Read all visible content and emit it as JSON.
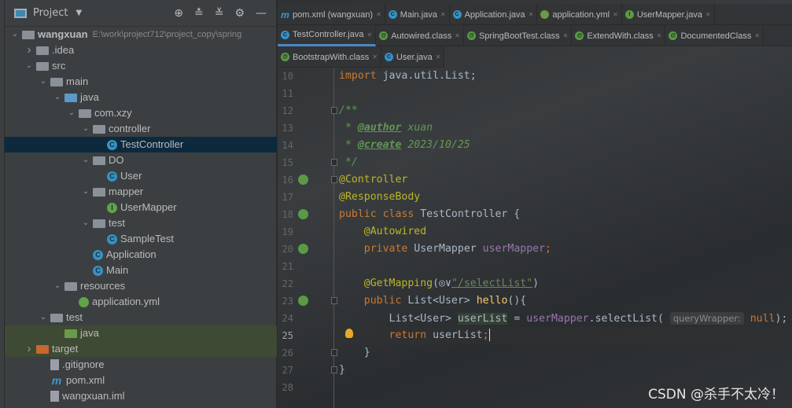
{
  "project_panel": {
    "title": "Project",
    "tools": [
      "locate-icon",
      "expand-all-icon",
      "collapse-all-icon",
      "gear-icon",
      "minimize-icon"
    ],
    "tree": [
      {
        "label": "wangxuan",
        "path": "E:\\work\\project712\\project_copy\\spring",
        "depth": 0,
        "chev": "v",
        "icon": "module"
      },
      {
        "label": ".idea",
        "depth": 1,
        "chev": ">",
        "icon": "folder"
      },
      {
        "label": "src",
        "depth": 1,
        "chev": "v",
        "icon": "folder"
      },
      {
        "label": "main",
        "depth": 2,
        "chev": "v",
        "icon": "folder"
      },
      {
        "label": "java",
        "depth": 3,
        "chev": "v",
        "icon": "folder-blue"
      },
      {
        "label": "com.xzy",
        "depth": 4,
        "chev": "v",
        "icon": "folder"
      },
      {
        "label": "controller",
        "depth": 5,
        "chev": "v",
        "icon": "folder"
      },
      {
        "label": "TestController",
        "depth": 6,
        "chev": "",
        "icon": "class",
        "selected": true
      },
      {
        "label": "DO",
        "depth": 5,
        "chev": "v",
        "icon": "folder"
      },
      {
        "label": "User",
        "depth": 6,
        "chev": "",
        "icon": "class"
      },
      {
        "label": "mapper",
        "depth": 5,
        "chev": "v",
        "icon": "folder"
      },
      {
        "label": "UserMapper",
        "depth": 6,
        "chev": "",
        "icon": "interface"
      },
      {
        "label": "test",
        "depth": 5,
        "chev": "v",
        "icon": "folder"
      },
      {
        "label": "SampleTest",
        "depth": 6,
        "chev": "",
        "icon": "class"
      },
      {
        "label": "Application",
        "depth": 5,
        "chev": "",
        "icon": "class"
      },
      {
        "label": "Main",
        "depth": 5,
        "chev": "",
        "icon": "class"
      },
      {
        "label": "resources",
        "depth": 3,
        "chev": "v",
        "icon": "folder"
      },
      {
        "label": "application.yml",
        "depth": 4,
        "chev": "",
        "icon": "yml"
      },
      {
        "label": "test",
        "depth": 2,
        "chev": "v",
        "icon": "folder"
      },
      {
        "label": "java",
        "depth": 3,
        "chev": "",
        "icon": "folder-green",
        "highlight": true
      },
      {
        "label": "target",
        "depth": 1,
        "chev": ">",
        "icon": "folder-orange",
        "highlight": true
      },
      {
        "label": ".gitignore",
        "depth": 2,
        "chev": "",
        "icon": "file"
      },
      {
        "label": "pom.xml",
        "depth": 2,
        "chev": "",
        "icon": "maven"
      },
      {
        "label": "wangxuan.iml",
        "depth": 2,
        "chev": "",
        "icon": "file"
      }
    ]
  },
  "tabs": [
    [
      {
        "label": "pom.xml (wangxuan)",
        "icon": "m"
      },
      {
        "label": "Main.java",
        "icon": "c"
      },
      {
        "label": "Application.java",
        "icon": "c"
      },
      {
        "label": "application.yml",
        "icon": "y"
      },
      {
        "label": "UserMapper.java",
        "icon": "i"
      }
    ],
    [
      {
        "label": "TestController.java",
        "icon": "c",
        "active": true
      },
      {
        "label": "Autowired.class",
        "icon": "a"
      },
      {
        "label": "SpringBootTest.class",
        "icon": "a"
      },
      {
        "label": "ExtendWith.class",
        "icon": "a"
      },
      {
        "label": "DocumentedClass",
        "icon": "a"
      }
    ],
    [
      {
        "label": "BootstrapWith.class",
        "icon": "a"
      },
      {
        "label": "User.java",
        "icon": "c"
      }
    ]
  ],
  "editor": {
    "current_line": 25,
    "lines": [
      {
        "n": 10,
        "t": [
          [
            "kw",
            "import "
          ],
          [
            "",
            "java.util.List;"
          ]
        ]
      },
      {
        "n": 11,
        "t": []
      },
      {
        "n": 12,
        "t": [
          [
            "doc",
            "/**"
          ]
        ]
      },
      {
        "n": 13,
        "t": [
          [
            "doc",
            " * "
          ],
          [
            "tag",
            "@author"
          ],
          [
            "doc",
            " xuan"
          ]
        ]
      },
      {
        "n": 14,
        "t": [
          [
            "doc",
            " * "
          ],
          [
            "tag",
            "@create"
          ],
          [
            "doc",
            " 2023/10/25"
          ]
        ]
      },
      {
        "n": 15,
        "t": [
          [
            "doc",
            " */"
          ]
        ]
      },
      {
        "n": 16,
        "t": [
          [
            "an",
            "@Controller"
          ]
        ]
      },
      {
        "n": 17,
        "t": [
          [
            "an",
            "@ResponseBody"
          ]
        ]
      },
      {
        "n": 18,
        "t": [
          [
            "kw",
            "public class "
          ],
          [
            "",
            "TestController {"
          ]
        ]
      },
      {
        "n": 19,
        "t": [
          [
            "",
            "    "
          ],
          [
            "an",
            "@Autowired"
          ]
        ]
      },
      {
        "n": 20,
        "t": [
          [
            "",
            "    "
          ],
          [
            "kw",
            "private "
          ],
          [
            "",
            "UserMapper "
          ],
          [
            "fld",
            "userMapper"
          ],
          [
            "kw",
            ";"
          ]
        ]
      },
      {
        "n": 21,
        "t": []
      },
      {
        "n": 22,
        "t": [
          [
            "",
            "    "
          ],
          [
            "an",
            "@GetMapping"
          ],
          [
            "",
            "(◎∨"
          ],
          [
            "str",
            "\"/selectList\""
          ],
          [
            "",
            ")"
          ]
        ]
      },
      {
        "n": 23,
        "t": [
          [
            "",
            "    "
          ],
          [
            "kw",
            "public "
          ],
          [
            "",
            "List<User> "
          ],
          [
            "fn",
            "hello"
          ],
          [
            "",
            "(){"
          ]
        ]
      },
      {
        "n": 24,
        "t": [
          [
            "",
            "        List<User> "
          ],
          [
            "hlvar",
            "userList"
          ],
          [
            "",
            " = "
          ],
          [
            "fld",
            "userMapper"
          ],
          [
            "",
            ".selectList( "
          ],
          [
            "hint",
            "queryWrapper:"
          ],
          [
            "kw",
            " null"
          ],
          [
            "",
            ");"
          ]
        ]
      },
      {
        "n": 25,
        "t": [
          [
            "",
            "        "
          ],
          [
            "kw",
            "return "
          ],
          [
            "",
            "userList"
          ],
          [
            "kw",
            ";"
          ]
        ]
      },
      {
        "n": 26,
        "t": [
          [
            "",
            "    }"
          ]
        ]
      },
      {
        "n": 27,
        "t": [
          [
            "",
            "}"
          ]
        ]
      },
      {
        "n": 28,
        "t": []
      }
    ]
  },
  "watermark": "CSDN @杀手不太冷！"
}
